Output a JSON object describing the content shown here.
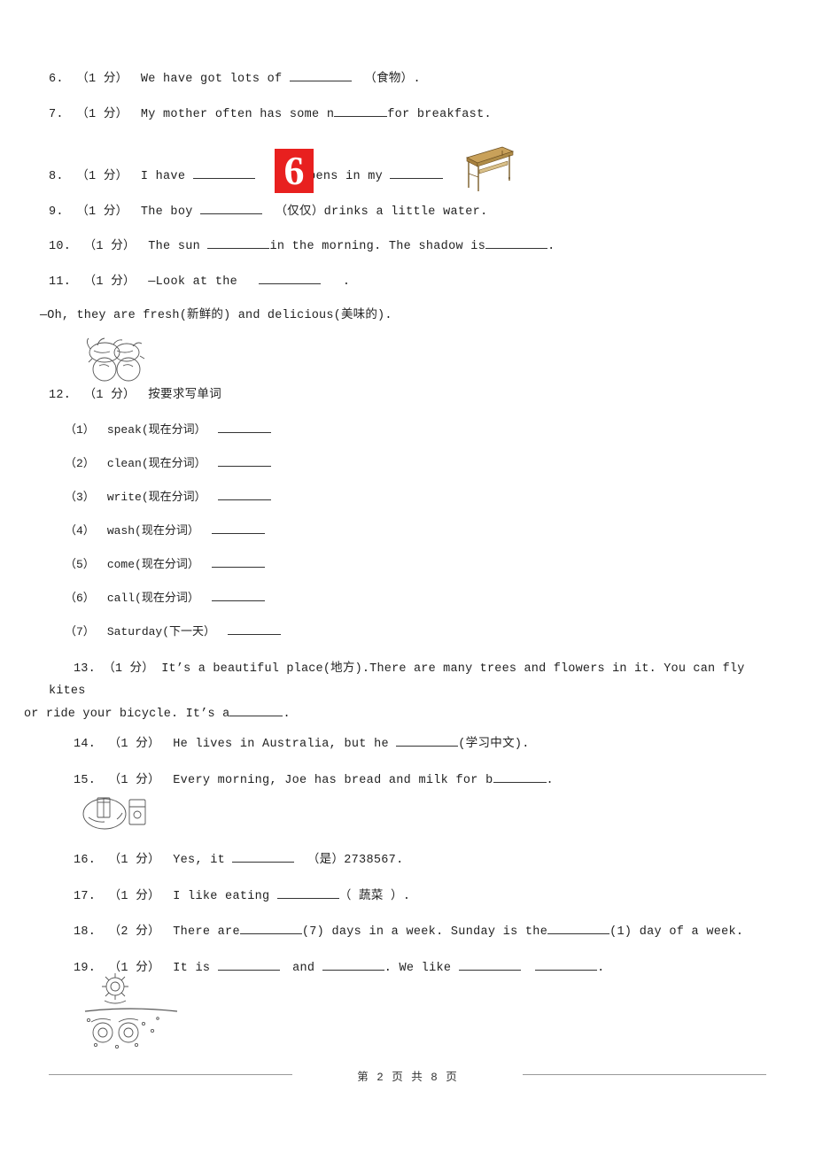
{
  "page": {
    "footer": "第 2 页 共 8 页"
  },
  "questions": [
    {
      "num": "6.",
      "pts": "（1 分）",
      "pre": "We have got lots of",
      "post": "（食物）."
    },
    {
      "num": "7.",
      "pts": "（1 分）",
      "pre": "My mother often has some n",
      "post": "for breakfast."
    },
    {
      "num": "8.",
      "pts": "（1 分）",
      "pre": "I have",
      "mid": "pens in my",
      "post": "."
    },
    {
      "num": "9.",
      "pts": "（1 分）",
      "pre": "The boy",
      "post": "（仅仅）drinks a little water."
    },
    {
      "num": "10.",
      "pts": "（1 分）",
      "pre": "The sun",
      "mid": "in the morning. The shadow is",
      "post": "."
    },
    {
      "num": "11.",
      "pts": "（1 分）",
      "pre": "—Look at the",
      "post": ".",
      "cont": "—Oh, they are fresh(新鲜的) and delicious(美味的)."
    },
    {
      "num": "12.",
      "pts": "（1 分）",
      "title": "按要求写单词",
      "subs": [
        {
          "n": "（1）",
          "t": "speak(现在分词）"
        },
        {
          "n": "（2）",
          "t": "clean(现在分词）"
        },
        {
          "n": "（3）",
          "t": "write(现在分词）"
        },
        {
          "n": "（4）",
          "t": "wash(现在分词）"
        },
        {
          "n": "（5）",
          "t": "come(现在分词）"
        },
        {
          "n": "（6）",
          "t": "call(现在分词）"
        },
        {
          "n": "（7）",
          "t": "Saturday(下一天）"
        }
      ]
    },
    {
      "num": "13.",
      "pts": "（1 分）",
      "line1": "It’s a beautiful place(地方).There are many trees and flowers in it. You can fly kites",
      "line2pre": "or ride your bicycle. It’s a",
      "line2post": "."
    },
    {
      "num": "14.",
      "pts": "（1 分）",
      "pre": "He lives in Australia, but he",
      "post": "(学习中文)."
    },
    {
      "num": "15.",
      "pts": "（1 分）",
      "pre": "Every morning, Joe has bread and milk for b",
      "post": "."
    },
    {
      "num": "16.",
      "pts": "（1 分）",
      "pre": "Yes, it",
      "post": "（是）2738567."
    },
    {
      "num": "17.",
      "pts": "（1 分）",
      "pre": "I like eating",
      "post": "（ 蔬菜 ）."
    },
    {
      "num": "18.",
      "pts": "（2 分）",
      "pre": "There are",
      "mid": "(7) days in a week. Sunday is the",
      "post": "(1) day of a week."
    },
    {
      "num": "19.",
      "pts": "（1 分）",
      "pre": "It is",
      "mid1": "and",
      "mid2": ". We like",
      "post": "."
    }
  ],
  "images": {
    "red_six": "6",
    "desk_icon": "desk-illustration",
    "fruit_icon": "fruit-illustration",
    "breakfast_icon": "breakfast-illustration",
    "sun_icon": "sun-and-shadow-illustration"
  }
}
